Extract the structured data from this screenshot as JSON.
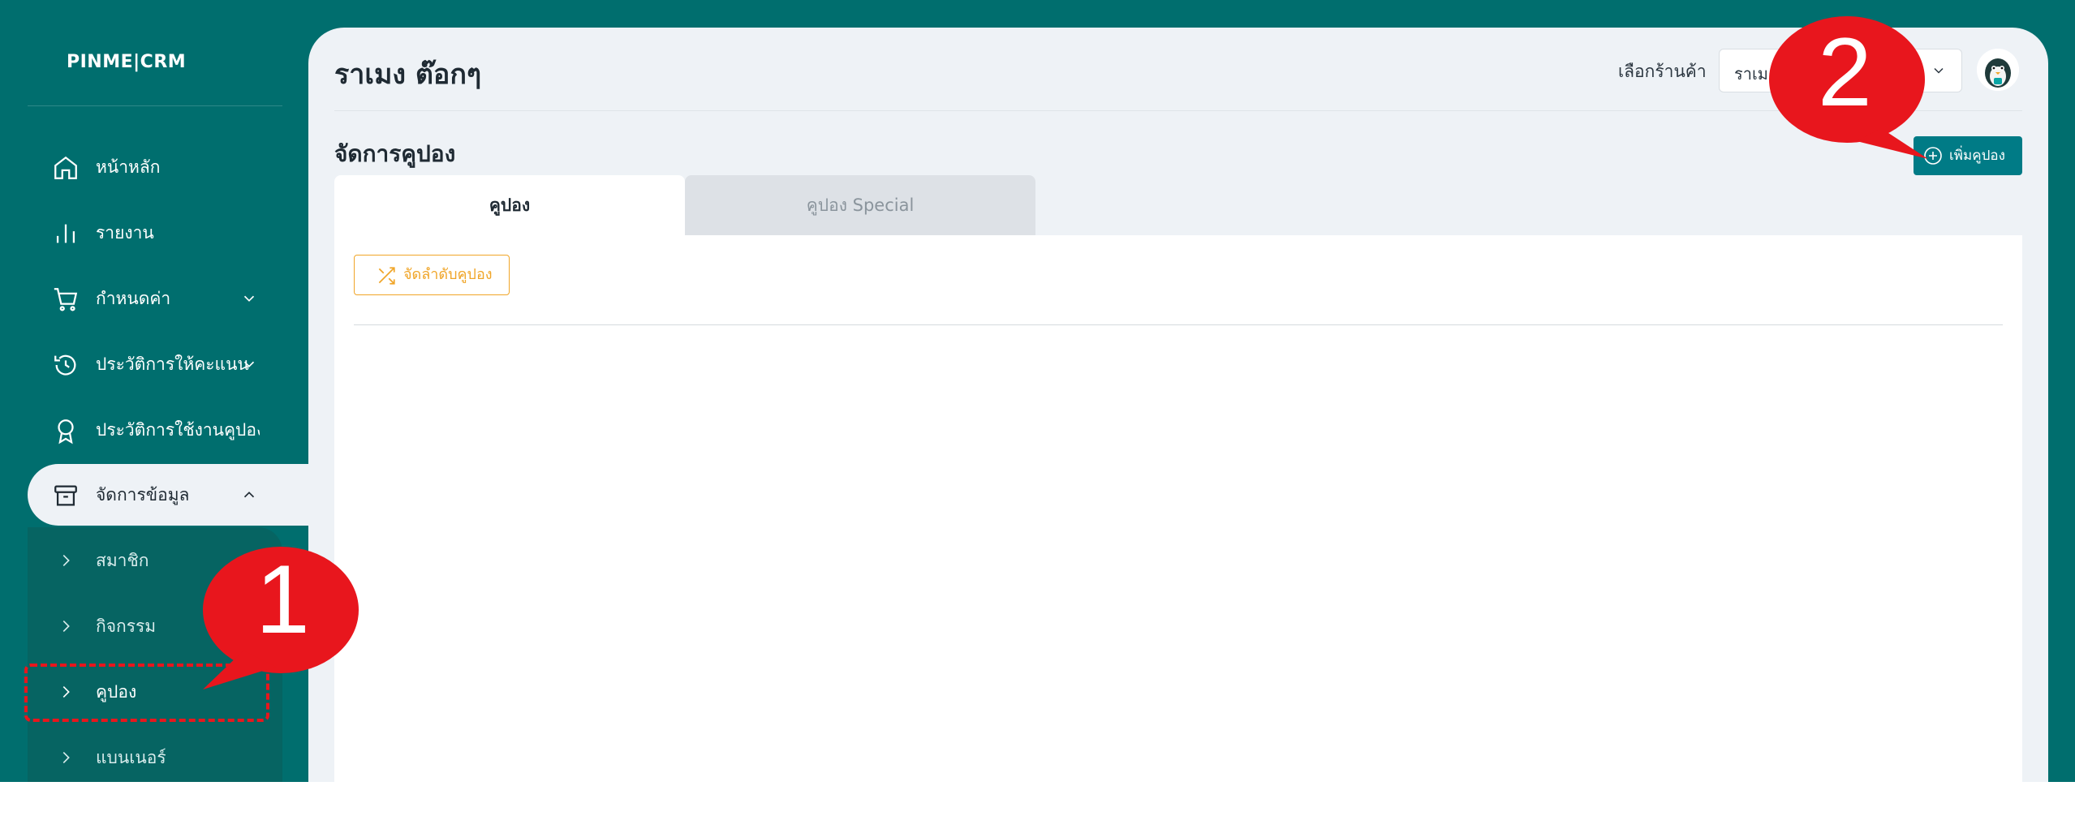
{
  "sidebar": {
    "logo": "PINME|CRM",
    "items": [
      {
        "label": "หน้าหลัก",
        "icon": "home-icon"
      },
      {
        "label": "รายงาน",
        "icon": "bar-chart-icon"
      },
      {
        "label": "กำหนดค่า",
        "icon": "cart-icon",
        "expandable": true
      },
      {
        "label": "ประวัติการให้คะแนน",
        "icon": "history-icon",
        "expandable": true
      },
      {
        "label": "ประวัติการใช้งานคูปอง",
        "icon": "award-icon"
      },
      {
        "label": "จัดการข้อมูล",
        "icon": "archive-icon",
        "expanded": true,
        "active": true
      }
    ],
    "submenu": [
      {
        "label": "สมาชิก"
      },
      {
        "label": "กิจกรรม"
      },
      {
        "label": "คูปอง"
      },
      {
        "label": "แบนเนอร์"
      }
    ]
  },
  "header": {
    "page_title": "ราเมง ต๊อกๆ",
    "store_label": "เลือกร้านค้า",
    "store_value": "ราเมง"
  },
  "main": {
    "section_title": "จัดการคูปอง",
    "add_button": "เพิ่มคูปอง",
    "tabs": [
      {
        "label": "คูปอง",
        "active": true
      },
      {
        "label": "คูปอง Special",
        "active": false
      }
    ],
    "sort_button": "จัดลำดับคูปอง"
  },
  "annotations": {
    "callout_1": "1",
    "callout_2": "2"
  },
  "colors": {
    "sidebar_bg": "#006e6e",
    "panel_bg": "#eef2f6",
    "primary_button": "#007b86",
    "sort_button": "#f0a528",
    "annotation_red": "#e8161d"
  }
}
